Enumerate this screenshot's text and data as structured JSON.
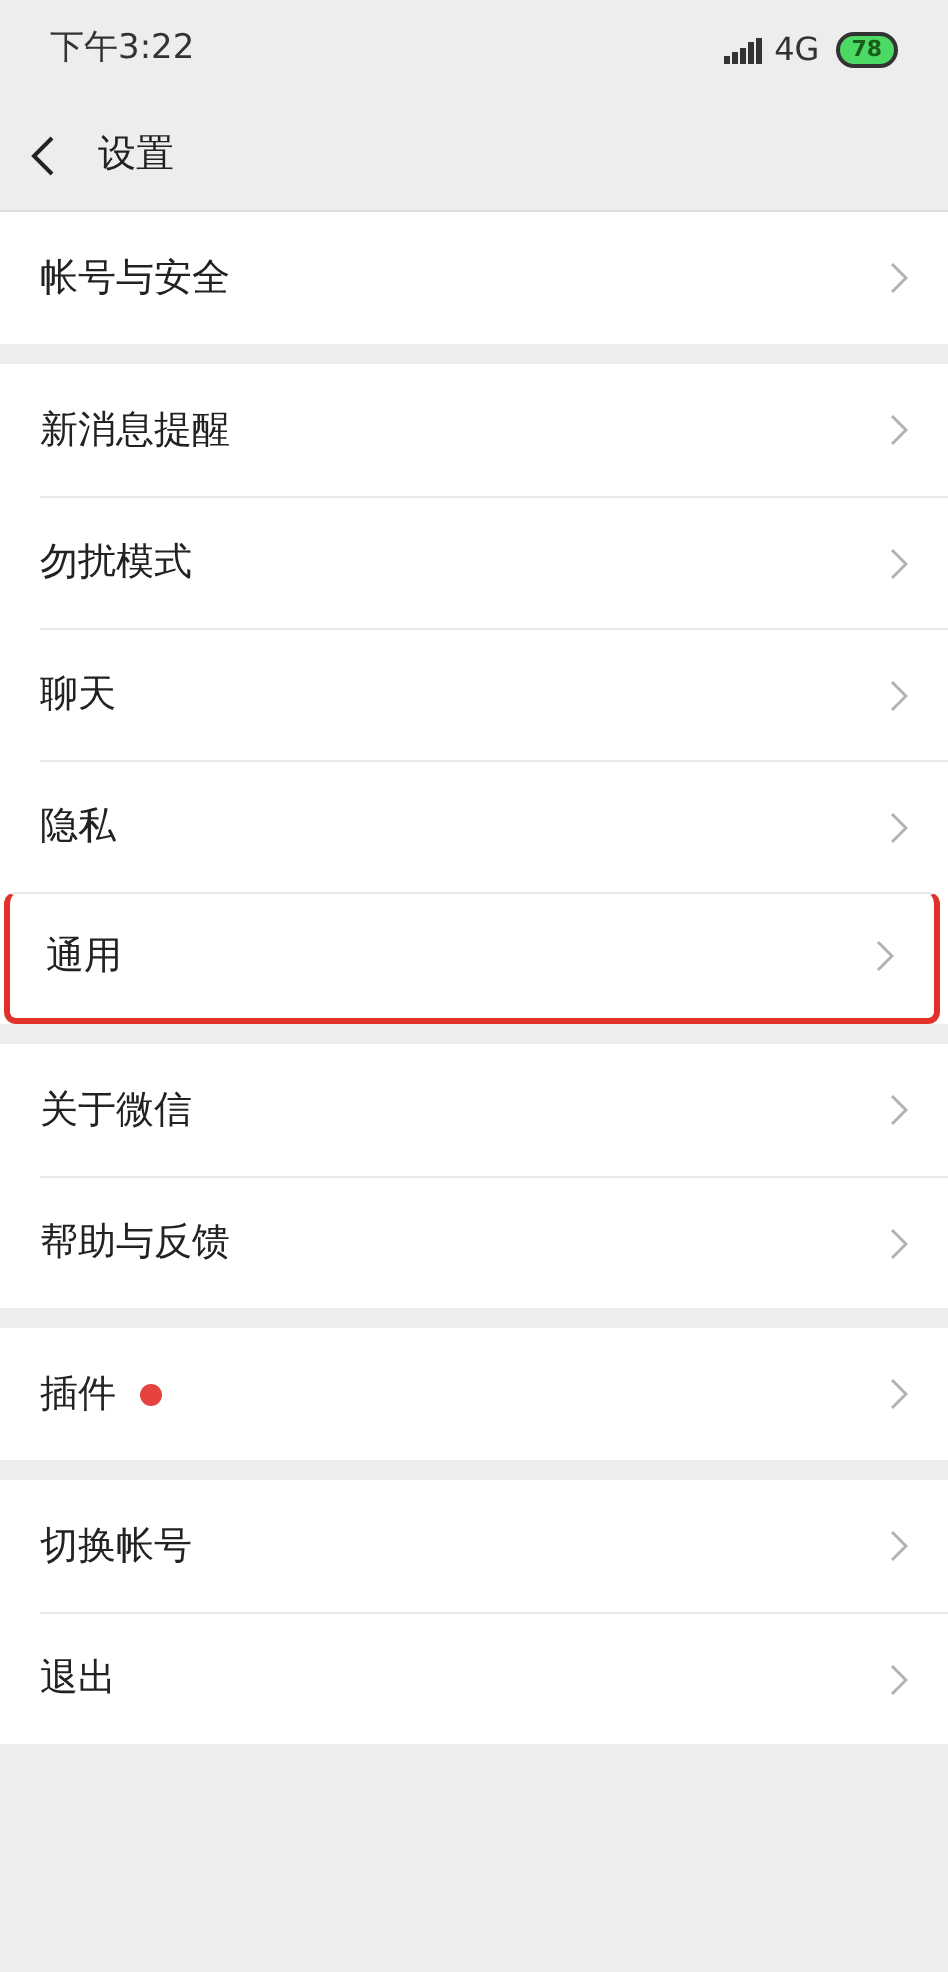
{
  "status_bar": {
    "time": "下午3:22",
    "network": "4G",
    "battery": "78"
  },
  "header": {
    "title": "设置"
  },
  "groups": [
    {
      "items": [
        {
          "label": "帐号与安全",
          "highlighted": false,
          "badge_dot": false
        }
      ]
    },
    {
      "items": [
        {
          "label": "新消息提醒",
          "highlighted": false,
          "badge_dot": false
        },
        {
          "label": "勿扰模式",
          "highlighted": false,
          "badge_dot": false
        },
        {
          "label": "聊天",
          "highlighted": false,
          "badge_dot": false
        },
        {
          "label": "隐私",
          "highlighted": false,
          "badge_dot": false
        },
        {
          "label": "通用",
          "highlighted": true,
          "badge_dot": false
        }
      ]
    },
    {
      "items": [
        {
          "label": "关于微信",
          "highlighted": false,
          "badge_dot": false
        },
        {
          "label": "帮助与反馈",
          "highlighted": false,
          "badge_dot": false
        }
      ]
    },
    {
      "items": [
        {
          "label": "插件",
          "highlighted": false,
          "badge_dot": true
        }
      ]
    },
    {
      "items": [
        {
          "label": "切换帐号",
          "highlighted": false,
          "badge_dot": false
        },
        {
          "label": "退出",
          "highlighted": false,
          "badge_dot": false
        }
      ]
    }
  ]
}
